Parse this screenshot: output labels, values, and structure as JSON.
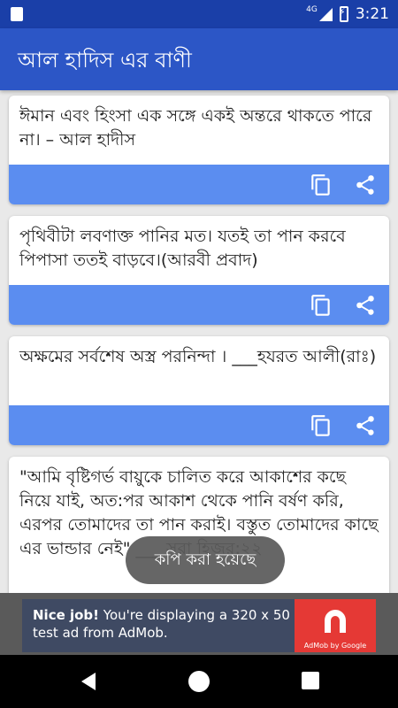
{
  "status_bar": {
    "network": "4G",
    "time": "3:21"
  },
  "app_bar": {
    "title": "আল হাদিস এর বাণী"
  },
  "cards": [
    {
      "text": "ঈমান এবং হিংসা এক সঙ্গে একই অন্তরে থাকতে পারে না। – আল হাদীস"
    },
    {
      "text": "পৃথিবীটা লবণাক্ত পানির মত। যতই তা পান করবে পিপাসা ততই বাড়বে।(আরবী প্রবাদ)"
    },
    {
      "text": "অক্ষমের সর্বশেষ অস্ত্র পরনিন্দা । ___হযরত আলী(রাঃ)"
    },
    {
      "text": "\"আমি বৃষ্টিগর্ভ বায়ুকে চালিত করে আকাশের কছে নিয়ে যাই, অত:পর আকাশ থেকে পানি বর্ষণ করি, এরপর তোমাদের তা পান করাই। বস্তুত তোমাদের কাছে এর ভান্ডার নেই\" ___ সূরা হিজর:২২"
    }
  ],
  "icons": {
    "copy": "copy-icon",
    "share": "share-icon"
  },
  "toast": {
    "text": "কপি করা হয়েছে"
  },
  "ad": {
    "headline": "Nice job!",
    "body": " You're displaying a 320 x 50 test ad from AdMob.",
    "brand": "AdMob by Google"
  },
  "colors": {
    "status_bar": "#1a3fa8",
    "app_bar": "#2c56c6",
    "card_action_bar": "#5b8df0",
    "ad_logo": "#e53935"
  }
}
